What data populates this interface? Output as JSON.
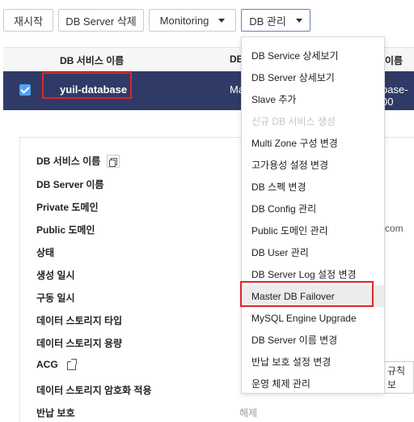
{
  "toolbar": {
    "restart_label": "재시작",
    "delete_label": "DB Server 삭제",
    "monitoring_label": "Monitoring",
    "manage_label": "DB 관리"
  },
  "table": {
    "headers": [
      "DB 서비스 이름",
      "DB",
      "r 이름"
    ],
    "row": {
      "name": "yuil-database",
      "col2": "Ma",
      "col3": "base-00"
    }
  },
  "detail": {
    "labels": [
      "DB 서비스 이름",
      "DB Server 이름",
      "Private 도메인",
      "Public 도메인",
      "상태",
      "생성 일시",
      "구동 일시",
      "데이터 스토리지 타입",
      "데이터 스토리지 용량",
      "ACG",
      "데이터 스토리지 암호화 적용",
      "반납 보호"
    ],
    "return_protection_value": "해제",
    "partial_com": "com",
    "partial_rule": "규칙 보"
  },
  "menu": {
    "items": [
      {
        "label": "DB Service 상세보기",
        "disabled": false
      },
      {
        "label": "DB Server 상세보기",
        "disabled": false
      },
      {
        "label": "Slave 추가",
        "disabled": false
      },
      {
        "label": "신규 DB 서비스 생성",
        "disabled": true
      },
      {
        "label": "Multi Zone 구성 변경",
        "disabled": false
      },
      {
        "label": "고가용성 설정 변경",
        "disabled": false
      },
      {
        "label": "DB 스펙 변경",
        "disabled": false
      },
      {
        "label": "DB Config 관리",
        "disabled": false
      },
      {
        "label": "Public 도메인 관리",
        "disabled": false
      },
      {
        "label": "DB User 관리",
        "disabled": false
      },
      {
        "label": "DB Server Log 설정 변경",
        "disabled": false
      },
      {
        "label": "Master DB Failover",
        "disabled": false,
        "highlighted": true
      },
      {
        "label": "MySQL Engine Upgrade",
        "disabled": false
      },
      {
        "label": "DB Server 이름 변경",
        "disabled": false
      },
      {
        "label": "반납 보호 설정 변경",
        "disabled": false
      },
      {
        "label": "운영 체제 관리",
        "disabled": false
      }
    ]
  },
  "colors": {
    "selected_row": "#2f3b66",
    "highlight_box": "#e0242a",
    "checkbox": "#4fa3f7"
  }
}
